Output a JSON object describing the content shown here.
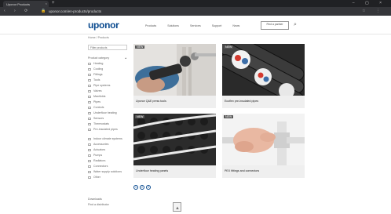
{
  "browser": {
    "tab_title": "Uponor Products",
    "tab_close": "×",
    "new_tab": "+",
    "window_controls": "– ▢ ×",
    "nav_buttons": "‹ › ⟳",
    "url": "uponor.com/en-products/products",
    "lock_icon": "🔒",
    "extension_icons": "☆ ⋮"
  },
  "site": {
    "logo": "uponor",
    "nav": [
      "Products",
      "Solutions",
      "Services",
      "Support",
      "News"
    ],
    "header_button": "Find a partner",
    "search_icon": "⌕"
  },
  "sidebar": {
    "breadcrumb": "Home / Products",
    "filter_label": "Filter products",
    "section_title": "Product category",
    "section_chevron": "▴",
    "items": [
      "Heating",
      "Cooling",
      "Fittings",
      "Tools",
      "Pipe systems",
      "Valves",
      "Manifolds",
      "Pipes",
      "Controls",
      "Underfloor heating",
      "Sensors",
      "Thermostats",
      "Pre-insulated pipes",
      "Indoor climate systems",
      "Accessories",
      "Actuators",
      "Pumps",
      "Radiators",
      "Connectors",
      "Water supply solutions",
      "Other"
    ],
    "footer": [
      "Downloads",
      "Find a distributor"
    ]
  },
  "cards": [
    {
      "label": "Uponor Q&E press tools",
      "badge": "NEW"
    },
    {
      "label": "Ecoflex pre-insulated pipes",
      "badge": "NEW"
    },
    {
      "label": "Underfloor heating panels",
      "badge": "NEW"
    },
    {
      "label": "PEX fittings and connectors",
      "badge": "NEW"
    }
  ],
  "pager": {
    "pages": [
      "1",
      "2",
      "3"
    ]
  },
  "feedback_icon": "▲"
}
